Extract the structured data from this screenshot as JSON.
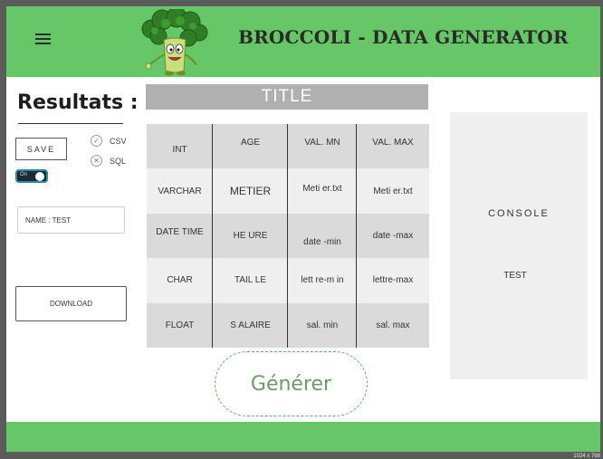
{
  "header": {
    "app_title": "BROCCOLI - DATA GENERATOR",
    "menu_icon": "hamburger-menu-icon",
    "logo_icon": "broccoli-mascot-logo"
  },
  "left_panel": {
    "heading": "Resultats :",
    "save_label": "SAVE",
    "formats": [
      {
        "label": "CSV",
        "icon": "check-circle-icon"
      },
      {
        "label": "SQL",
        "icon": "x-circle-icon"
      }
    ],
    "toggle": {
      "label": "On",
      "state": "on"
    },
    "name_input_value": "NAME : TEST",
    "download_label": "DOWNLOAD"
  },
  "table": {
    "title": "TITLE",
    "rows": [
      [
        "INT",
        "AGE",
        "VAL. MN",
        "VAL. MAX"
      ],
      [
        "VARCHAR",
        "METIER",
        "Meti er.txt",
        "Meti er.txt"
      ],
      [
        "DATE TIME",
        "HE URE",
        "date -min",
        "date -max"
      ],
      [
        "CHAR",
        "TAIL LE",
        "lett re-m in",
        "lettre-max"
      ],
      [
        "FLOAT",
        "S ALAIRE",
        "sal. min",
        "sal. max"
      ]
    ]
  },
  "generate_label": "Générer",
  "console": {
    "title": "CONSOLE",
    "text": "TEST"
  },
  "screen_size_label": "1024 x 768",
  "colors": {
    "header_green": "#66c766",
    "title_bar_gray": "#b0b0b0",
    "console_bg": "#efefef"
  }
}
